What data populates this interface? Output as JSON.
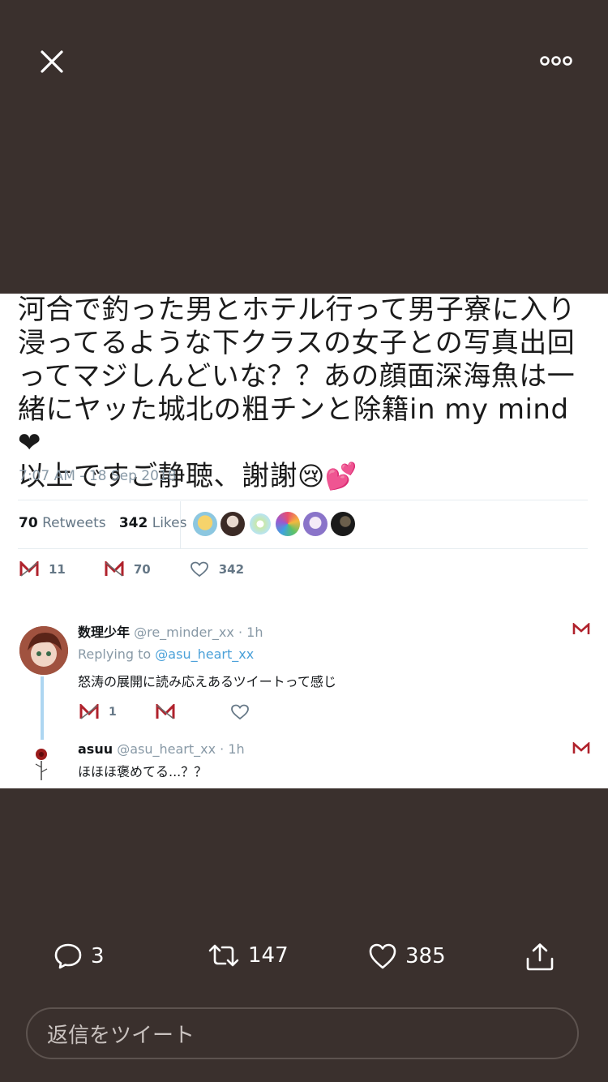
{
  "viewer": {
    "icons": {
      "close": "close-icon",
      "more": "more-horizontal-icon"
    }
  },
  "embedded_tweet": {
    "text_lines": [
      "河合で釣った男とホテル行って男子寮に入り",
      "浸ってるような下クラスの女子との写真出回",
      "ってマジしんどいな？？あの顔面深海魚は一",
      "緒にヤッた城北の粗チンと除籍in my mind❤",
      "以上ですご静聴、謝謝"
    ],
    "emojis": "😢💕",
    "timestamp": "7:07 AM - 18 Sep 2018",
    "retweets_count": "70",
    "retweets_label": "Retweets",
    "likes_count": "342",
    "likes_label": "Likes",
    "actions": {
      "reply_count": "11",
      "retweet_count": "70",
      "like_count": "342"
    }
  },
  "reply": {
    "name": "数理少年",
    "handle": "@re_minder_xx",
    "time": "· 1h",
    "replying_prefix": "Replying to",
    "replying_to": "@asu_heart_xx",
    "body": "怒涛の展開に読み応えあるツイートって感じ",
    "reply_count": "1"
  },
  "reply2": {
    "name": "asuu",
    "handle": "@asu_heart_xx",
    "time": "· 1h",
    "body": "ほほほ褒めてる...？？"
  },
  "toolbar": {
    "reply_count": "3",
    "retweet_count": "147",
    "like_count": "385",
    "reply_placeholder": "返信をツイート"
  },
  "colors": {
    "background": "#3a302d",
    "link": "#4ba1d9",
    "muted": "#8899a6",
    "reply_icon": "#b0222c"
  }
}
